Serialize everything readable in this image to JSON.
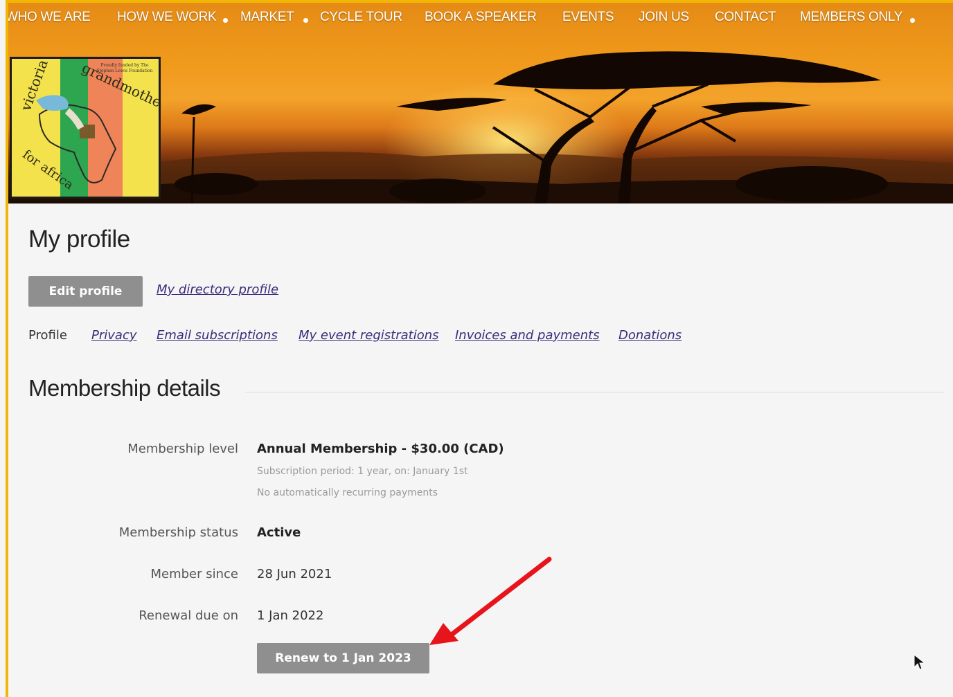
{
  "nav": {
    "items": [
      {
        "label": "WHO WE ARE",
        "dot": false
      },
      {
        "label": "HOW WE WORK",
        "dot": true
      },
      {
        "label": "MARKET",
        "dot": true
      },
      {
        "label": "CYCLE TOUR",
        "dot": false
      },
      {
        "label": "BOOK A SPEAKER",
        "dot": false
      },
      {
        "label": "EVENTS",
        "dot": false
      },
      {
        "label": "JOIN US",
        "dot": false
      },
      {
        "label": "CONTACT",
        "dot": false
      },
      {
        "label": "MEMBERS ONLY",
        "dot": true
      }
    ]
  },
  "logo": {
    "text_top": "victoria grandmothers",
    "text_bottom": "for africa",
    "tagline": "Proudly funded by The Stephen Lewis Foundation"
  },
  "page": {
    "title": "My profile",
    "edit_button": "Edit profile",
    "directory_link": "My directory profile"
  },
  "tabs": [
    {
      "label": "Profile",
      "active": true
    },
    {
      "label": "Privacy",
      "active": false
    },
    {
      "label": "Email subscriptions",
      "active": false
    },
    {
      "label": "My event registrations",
      "active": false
    },
    {
      "label": "Invoices and payments",
      "active": false
    },
    {
      "label": "Donations",
      "active": false
    }
  ],
  "membership": {
    "section_title": "Membership details",
    "level_label": "Membership level",
    "level_value": "Annual Membership - $30.00 (CAD)",
    "subscription_period": "Subscription period: 1 year, on: January 1st",
    "recurring_note": "No automatically recurring payments",
    "status_label": "Membership status",
    "status_value": "Active",
    "since_label": "Member since",
    "since_value": "28 Jun 2021",
    "renewal_label": "Renewal due on",
    "renewal_value": "1 Jan 2022",
    "renew_button": "Renew to 1 Jan 2023"
  },
  "colors": {
    "frame_accent": "#f2b705",
    "link": "#3d2a7a",
    "button_bg": "#8f8f8f",
    "arrow": "#e8141b"
  }
}
